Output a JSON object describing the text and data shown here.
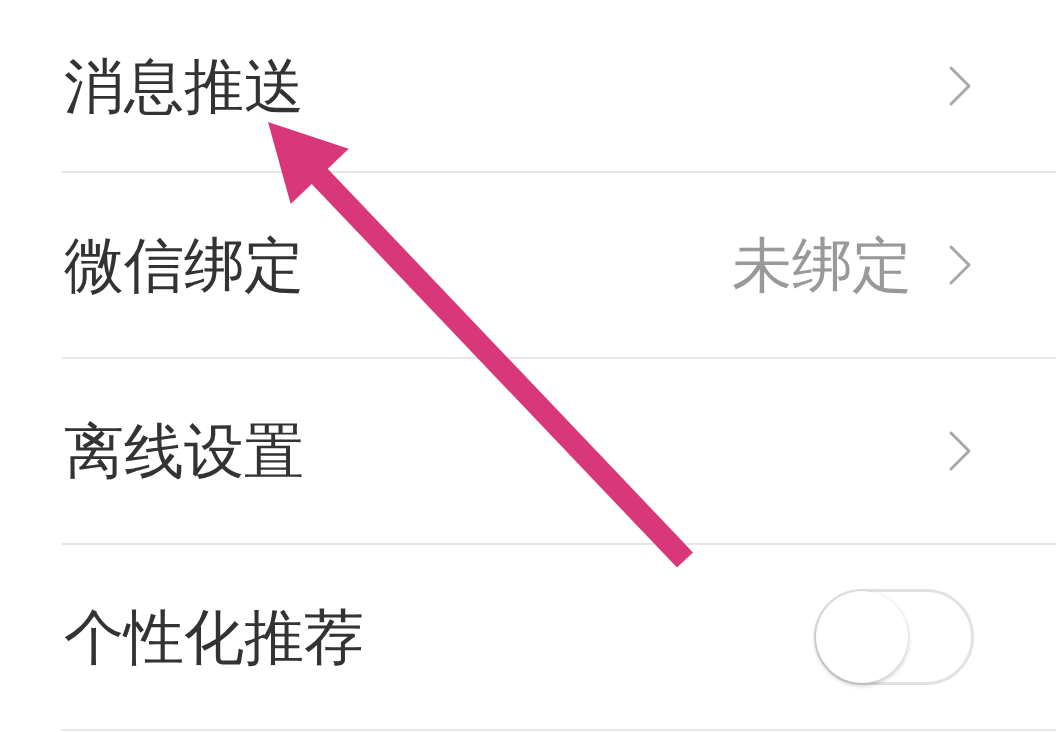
{
  "rows": [
    {
      "kind": "link",
      "label": "消息推送"
    },
    {
      "kind": "link",
      "label": "微信绑定",
      "value": "未绑定"
    },
    {
      "kind": "link",
      "label": "离线设置"
    },
    {
      "kind": "toggle",
      "label": "个性化推荐",
      "on": false
    }
  ],
  "annotations": [
    {
      "kind": "arrow"
    }
  ]
}
